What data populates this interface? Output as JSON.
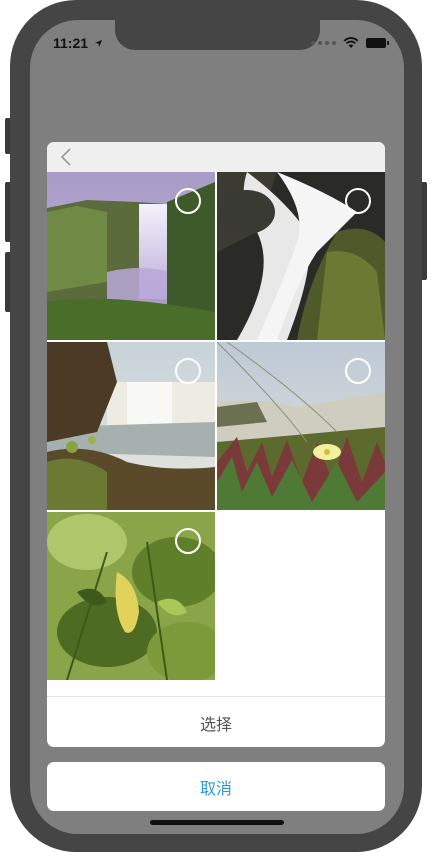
{
  "status_bar": {
    "time": "11:21",
    "location_icon": "location-arrow-icon",
    "wifi_icon": "wifi-icon",
    "battery_icon": "battery-icon"
  },
  "picker": {
    "back_icon": "chevron-left-icon",
    "photos": [
      {
        "name": "waterfall-meadow"
      },
      {
        "name": "waterfall-longexposure"
      },
      {
        "name": "waterfall-river"
      },
      {
        "name": "beach-flower"
      },
      {
        "name": "green-leaves"
      }
    ],
    "select_label": "选择",
    "cancel_label": "取消"
  }
}
